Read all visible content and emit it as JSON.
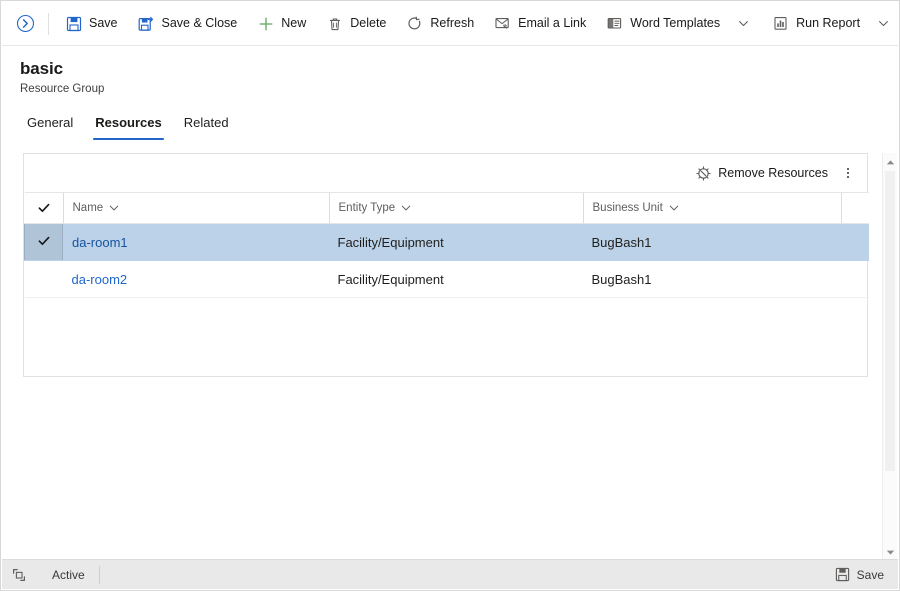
{
  "command_bar": {
    "nav_toggle_icon": "chevron-right-circle-icon",
    "commands": [
      {
        "label": "Save",
        "icon": "save-floppy-icon",
        "caret": false
      },
      {
        "label": "Save & Close",
        "icon": "save-and-close-icon",
        "caret": false
      },
      {
        "label": "New",
        "icon": "plus-icon",
        "caret": false
      },
      {
        "label": "Delete",
        "icon": "trash-icon",
        "caret": false
      },
      {
        "label": "Refresh",
        "icon": "refresh-circular-arrow-icon",
        "caret": false
      },
      {
        "label": "Email a Link",
        "icon": "email-link-icon",
        "caret": false
      },
      {
        "label": "Word Templates",
        "icon": "word-document-icon",
        "caret": true
      },
      {
        "label": "Run Report",
        "icon": "report-chart-icon",
        "caret": true
      }
    ]
  },
  "record": {
    "title": "basic",
    "subtitle": "Resource Group"
  },
  "tabs": [
    {
      "label": "General",
      "active": false
    },
    {
      "label": "Resources",
      "active": true
    },
    {
      "label": "Related",
      "active": false
    }
  ],
  "grid": {
    "commands": [
      {
        "label": "Remove Resources",
        "icon": "remove-resource-icon"
      }
    ],
    "overflow_icon": "more-vertical-icon",
    "select_all_icon": "checkmark-icon",
    "sort_icon": "chevron-down-icon",
    "columns": [
      {
        "label": "Name"
      },
      {
        "label": "Entity Type"
      },
      {
        "label": "Business Unit"
      }
    ],
    "rows": [
      {
        "selected": true,
        "check_icon": "checkmark-icon",
        "name": "da-room1",
        "entity_type": "Facility/Equipment",
        "business_unit": "BugBash1"
      },
      {
        "selected": false,
        "check_icon": "",
        "name": "da-room2",
        "entity_type": "Facility/Equipment",
        "business_unit": "BugBash1"
      }
    ]
  },
  "scrollbar": {
    "up_icon": "caret-up-icon",
    "down_icon": "caret-down-icon"
  },
  "footer": {
    "expand_icon": "expand-icon",
    "status": "Active",
    "save_label": "Save",
    "save_icon": "save-floppy-icon"
  },
  "colors": {
    "accent_blue": "#2266cc",
    "link_blue": "#2266cc",
    "selection_blue": "#bcd2e8",
    "new_green": "#5ea75e",
    "icon_grey": "#605e5c",
    "footer_grey": "#e9e9e9"
  }
}
